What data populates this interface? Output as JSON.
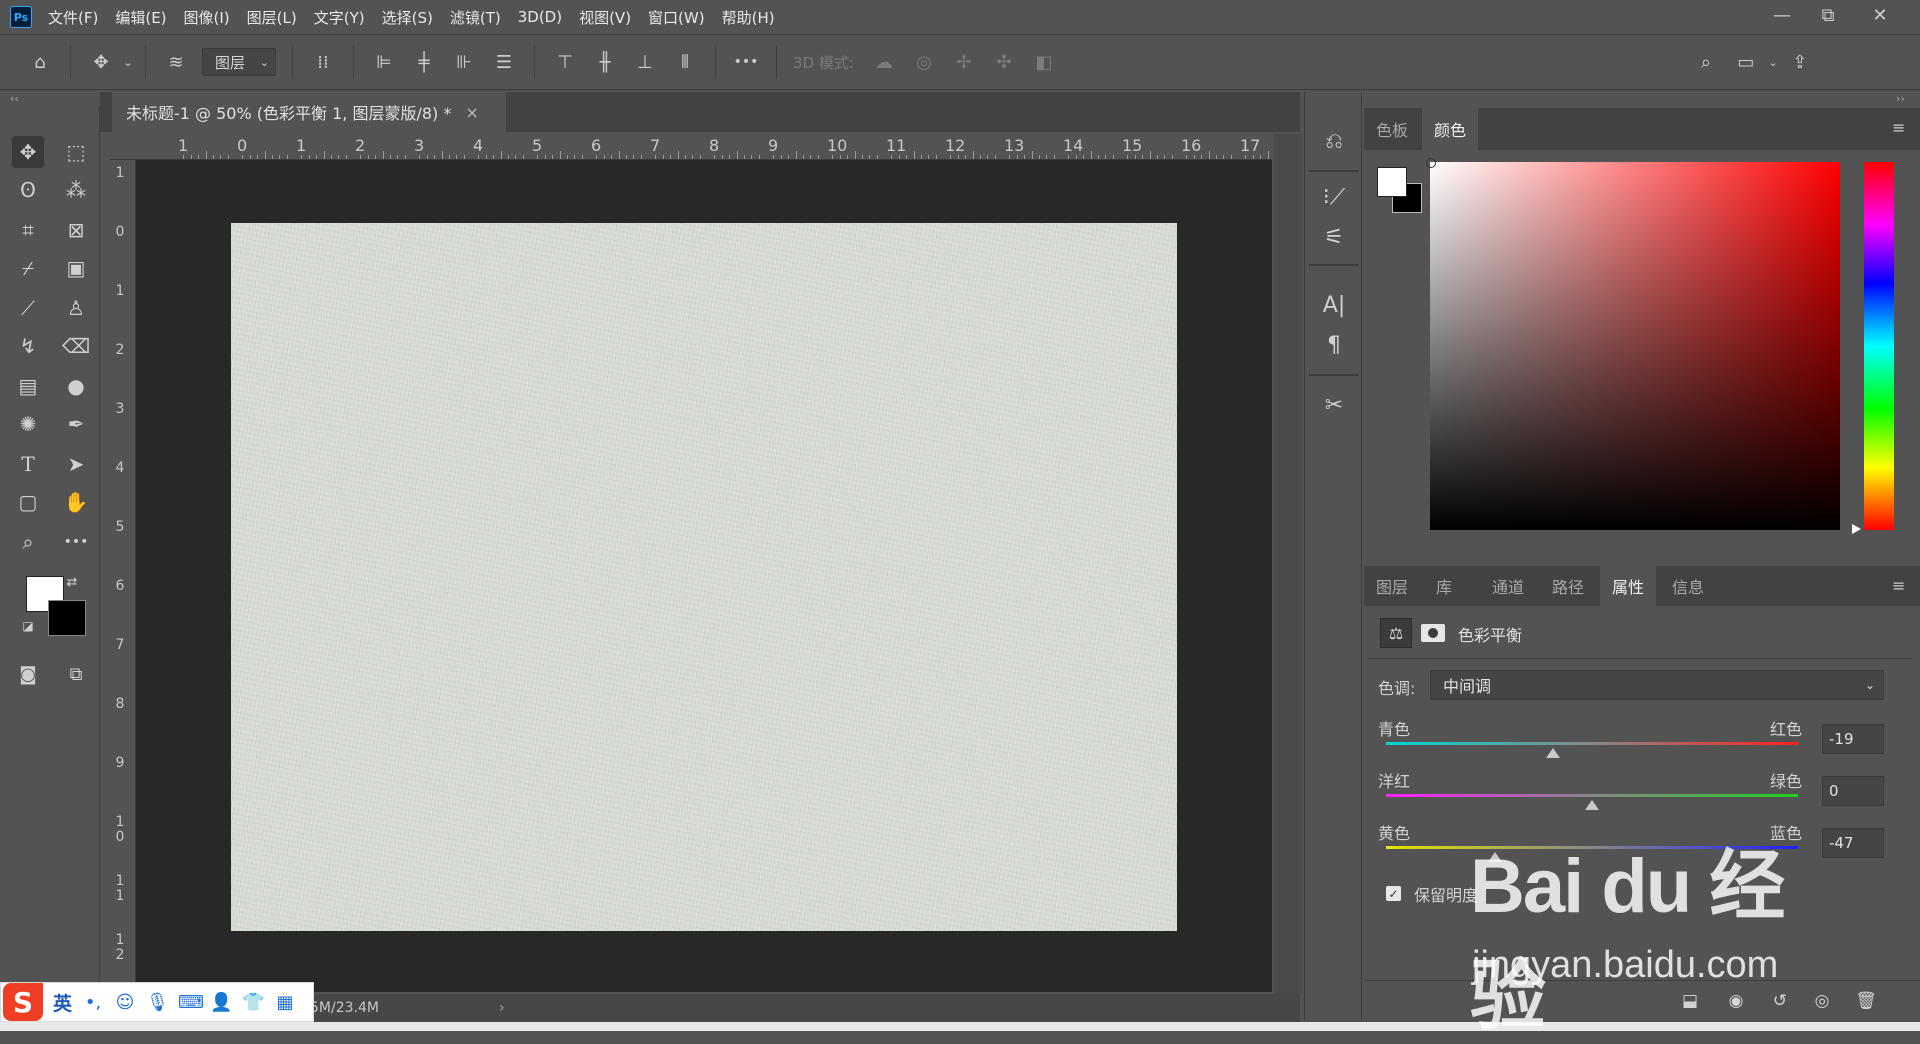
{
  "app": {
    "logo_text": "Ps",
    "menu": [
      "文件(F)",
      "编辑(E)",
      "图像(I)",
      "图层(L)",
      "文字(Y)",
      "选择(S)",
      "滤镜(T)",
      "3D(D)",
      "视图(V)",
      "窗口(W)",
      "帮助(H)"
    ]
  },
  "window_controls": {
    "minimize": "—",
    "restore": "⧉",
    "close": "✕"
  },
  "options_bar": {
    "layer_select_value": "图层",
    "mode_3d_label": "3D 模式:",
    "more": "•••"
  },
  "document": {
    "tab_title": "未标题-1 @ 50% (色彩平衡 1, 图层蒙版/8) *",
    "close": "×",
    "status_text": "5M/23.4M",
    "status_arrow": "›"
  },
  "rulers": {
    "horizontal": [
      "1",
      "0",
      "1",
      "2",
      "3",
      "4",
      "5",
      "6",
      "7",
      "8",
      "9",
      "10",
      "11",
      "12",
      "13",
      "14",
      "15",
      "16",
      "17"
    ],
    "vertical": [
      "1",
      "0",
      "1",
      "2",
      "3",
      "4",
      "5",
      "6",
      "7",
      "8",
      "9",
      "1\n0",
      "1\n1",
      "1\n2"
    ]
  },
  "color_panel": {
    "tabs": [
      "色板",
      "颜色"
    ],
    "active_tab": "颜色",
    "foreground": "#ffffff",
    "background": "#000000",
    "hue_color": "#ff0000"
  },
  "properties_panel": {
    "tabs": [
      "图层",
      "库",
      "通道",
      "路径",
      "属性",
      "信息"
    ],
    "active_tab": "属性",
    "title": "色彩平衡",
    "tone_label": "色调:",
    "tone_value": "中间调",
    "sliders": [
      {
        "left": "青色",
        "right": "红色",
        "value": "-19",
        "fraction": 0.405
      },
      {
        "left": "洋红",
        "right": "绿色",
        "value": "0",
        "fraction": 0.5
      },
      {
        "left": "黄色",
        "right": "蓝色",
        "value": "-47",
        "fraction": 0.265
      }
    ],
    "preserve_luminosity_label": "保留明度",
    "preserve_luminosity_checked": true
  },
  "ime": {
    "lang": "英",
    "punct": "•,"
  },
  "watermark": {
    "brand": "Bai du 经验",
    "url": "jingyan.baidu.com"
  }
}
